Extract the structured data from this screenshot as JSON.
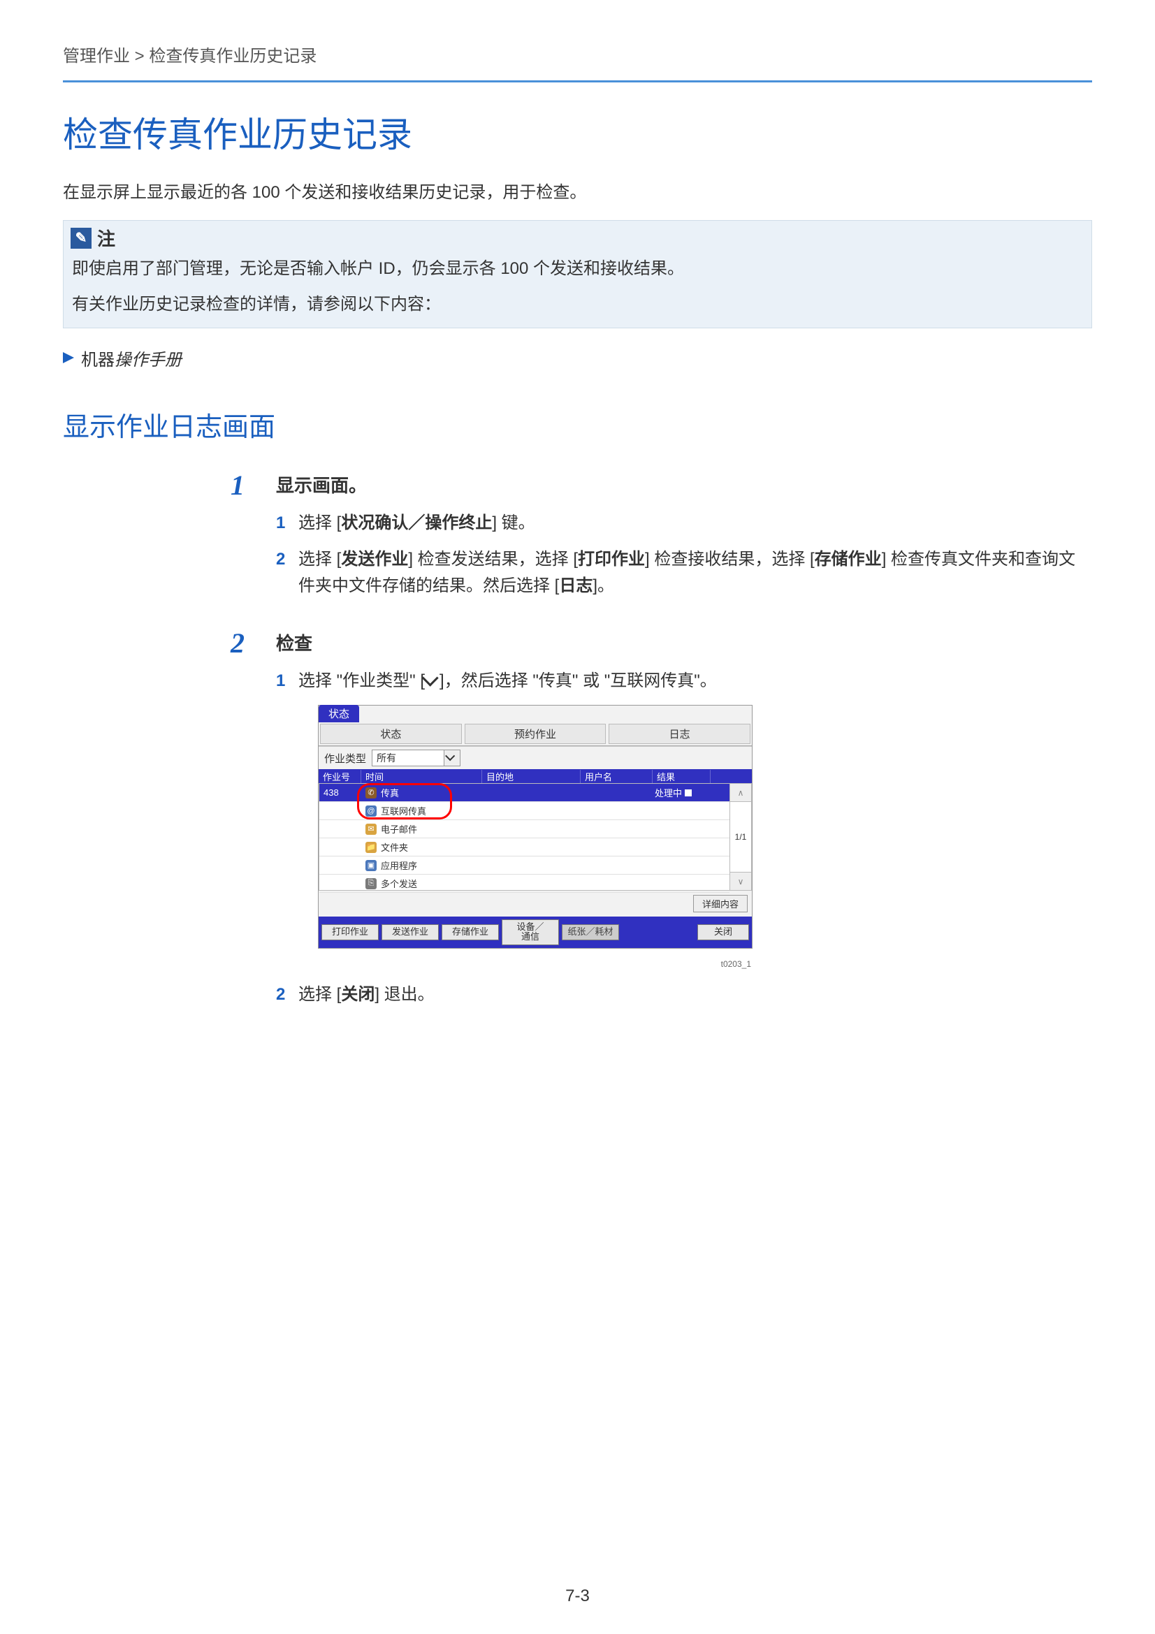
{
  "breadcrumb": "管理作业 > 检查传真作业历史记录",
  "heading_main": "检查传真作业历史记录",
  "intro": "在显示屏上显示最近的各 100 个发送和接收结果历史记录，用于检查。",
  "note": {
    "label": "注",
    "line1": "即使启用了部门管理，无论是否输入帐户 ID，仍会显示各 100 个发送和接收结果。",
    "line2": "有关作业历史记录检查的详情，请参阅以下内容："
  },
  "reference_prefix": "机器",
  "reference_italic": "操作手册",
  "heading_section": "显示作业日志画面",
  "step1": {
    "num": "1",
    "title": "显示画面。",
    "item1": {
      "num": "1",
      "text_a": "选择 [",
      "text_b": "状况确认／操作终止",
      "text_c": "] 键。"
    },
    "item2": {
      "num": "2",
      "text_a": "选择 [",
      "b1": "发送作业",
      "text_b": "] 检查发送结果，选择 [",
      "b2": "打印作业",
      "text_c": "] 检查接收结果，选择 [",
      "b3": "存储作业",
      "text_d": "] 检查传真文件夹和查询文件夹中文件存储的结果。然后选择 [",
      "b4": "日志",
      "text_e": "]。"
    }
  },
  "step2": {
    "num": "2",
    "title": "检查",
    "item1": {
      "num": "1",
      "text": "选择 \"作业类型\" [",
      "text2": "]，然后选择 \"传真\" 或 \"互联网传真\"。"
    },
    "item2": {
      "num": "2",
      "text_a": "选择 [",
      "b1": "关闭",
      "text_b": "] 退出。"
    }
  },
  "ui": {
    "status_tab": "状态",
    "top_tabs": {
      "status": "状态",
      "reserved": "预约作业",
      "log": "日志"
    },
    "jobtype_label": "作业类型",
    "jobtype_value": "所有",
    "headers": {
      "jobno": "作业号",
      "time": "时间",
      "dest": "目的地",
      "user": "用户名",
      "result": "结果"
    },
    "first_row": {
      "jobno": "438",
      "result": "处理中"
    },
    "options": {
      "fax": "传真",
      "ifax": "互联网传真",
      "email": "电子邮件",
      "folder": "文件夹",
      "app": "应用程序",
      "multi": "多个发送"
    },
    "page_indicator": "1/1",
    "detail_btn": "详细内容",
    "bottom": {
      "print": "打印作业",
      "send": "发送作业",
      "store": "存储作业",
      "device": "设备／\n通信",
      "paper": "纸张／耗材",
      "close": "关闭"
    },
    "fig_code": "t0203_1"
  },
  "page_number": "7-3"
}
